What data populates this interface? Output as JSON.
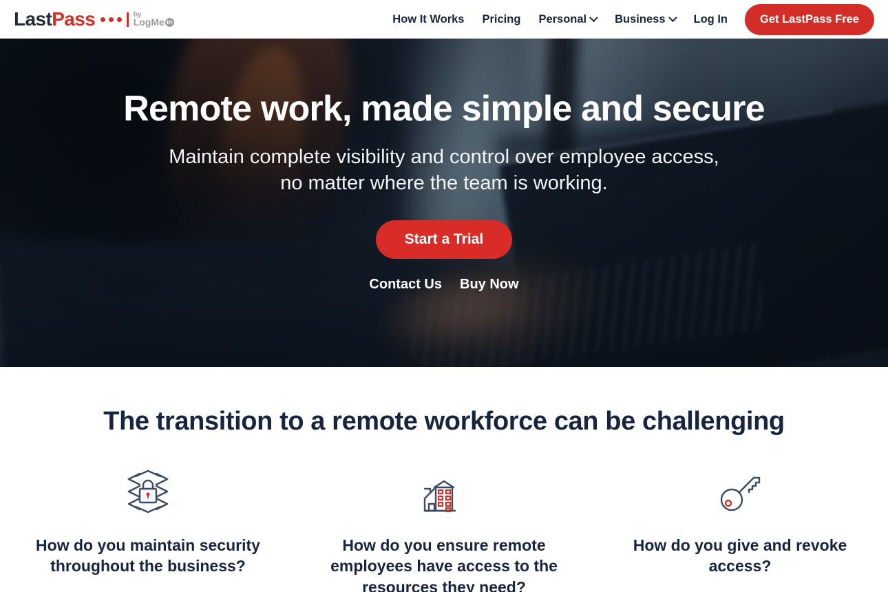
{
  "brand": {
    "logo_last": "Last",
    "logo_pass": "Pass",
    "logo_by": "by",
    "logo_logmein": "LogMe",
    "logo_in_badge": "in",
    "red": "#d32d27",
    "navy": "#17253f"
  },
  "nav": {
    "items": [
      {
        "label": "How It Works",
        "has_caret": false
      },
      {
        "label": "Pricing",
        "has_caret": false
      },
      {
        "label": "Personal",
        "has_caret": true
      },
      {
        "label": "Business",
        "has_caret": true
      },
      {
        "label": "Log In",
        "has_caret": false
      }
    ],
    "cta_label": "Get LastPass Free"
  },
  "hero": {
    "title": "Remote work, made simple and secure",
    "subtitle_line1": "Maintain complete visibility and control over employee access,",
    "subtitle_line2": "no matter where the team is working.",
    "cta_label": "Start a Trial",
    "links": [
      {
        "label": "Contact Us"
      },
      {
        "label": "Buy Now"
      }
    ]
  },
  "features": {
    "heading": "The transition to a remote workforce can be challenging",
    "items": [
      {
        "icon": "padlock-shield-icon",
        "text": "How do you maintain security throughout the business?"
      },
      {
        "icon": "office-building-icon",
        "text": "How do you ensure remote employees have access to the resources they need?"
      },
      {
        "icon": "key-icon",
        "text": "How do you give and revoke access?"
      }
    ]
  }
}
